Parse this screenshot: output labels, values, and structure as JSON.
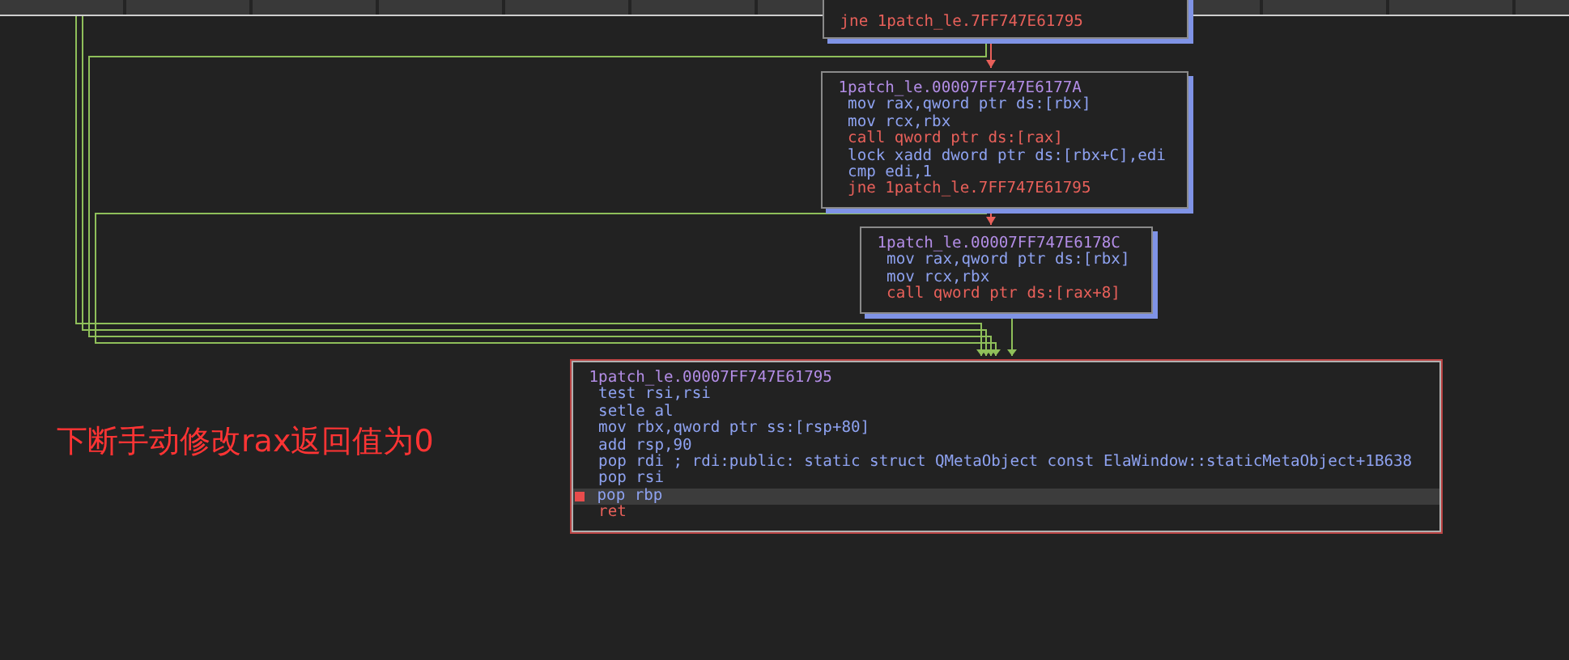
{
  "blocks": [
    {
      "lines": [
        {
          "text": "jne 1patch_le.7FF747E61795",
          "kind": "jump",
          "selected": false,
          "breakpoint": false
        }
      ]
    },
    {
      "lines": [
        {
          "text": "1patch_le.00007FF747E6177A",
          "kind": "label",
          "selected": false,
          "breakpoint": false
        },
        {
          "text": " mov rax,qword ptr ds:[rbx]",
          "kind": "op",
          "selected": false,
          "breakpoint": false
        },
        {
          "text": " mov rcx,rbx",
          "kind": "op",
          "selected": false,
          "breakpoint": false
        },
        {
          "text": " call qword ptr ds:[rax]",
          "kind": "call",
          "selected": false,
          "breakpoint": false
        },
        {
          "text": " lock xadd dword ptr ds:[rbx+C],edi",
          "kind": "op",
          "selected": false,
          "breakpoint": false
        },
        {
          "text": " cmp edi,1",
          "kind": "op",
          "selected": false,
          "breakpoint": false
        },
        {
          "text": " jne 1patch_le.7FF747E61795",
          "kind": "jump",
          "selected": false,
          "breakpoint": false
        }
      ]
    },
    {
      "lines": [
        {
          "text": "1patch_le.00007FF747E6178C",
          "kind": "label",
          "selected": false,
          "breakpoint": false
        },
        {
          "text": " mov rax,qword ptr ds:[rbx]",
          "kind": "op",
          "selected": false,
          "breakpoint": false
        },
        {
          "text": " mov rcx,rbx",
          "kind": "op",
          "selected": false,
          "breakpoint": false
        },
        {
          "text": " call qword ptr ds:[rax+8]",
          "kind": "call",
          "selected": false,
          "breakpoint": false
        }
      ]
    },
    {
      "lines": [
        {
          "text": "1patch_le.00007FF747E61795",
          "kind": "label",
          "selected": false,
          "breakpoint": false
        },
        {
          "text": " test rsi,rsi",
          "kind": "op",
          "selected": false,
          "breakpoint": false
        },
        {
          "text": " setle al",
          "kind": "op",
          "selected": false,
          "breakpoint": false
        },
        {
          "text": " mov rbx,qword ptr ss:[rsp+80]",
          "kind": "op",
          "selected": false,
          "breakpoint": false
        },
        {
          "text": " add rsp,90",
          "kind": "op",
          "selected": false,
          "breakpoint": false
        },
        {
          "text": " pop rdi ; rdi:public: static struct QMetaObject const ElaWindow::staticMetaObject+1B638",
          "kind": "op",
          "selected": false,
          "breakpoint": false
        },
        {
          "text": " pop rsi",
          "kind": "op",
          "selected": false,
          "breakpoint": false
        },
        {
          "text": "pop rbp",
          "kind": "op",
          "selected": true,
          "breakpoint": true
        },
        {
          "text": " ret",
          "kind": "ret",
          "selected": false,
          "breakpoint": false
        }
      ]
    }
  ],
  "annotation": "下断手动修改rax返回值为0"
}
